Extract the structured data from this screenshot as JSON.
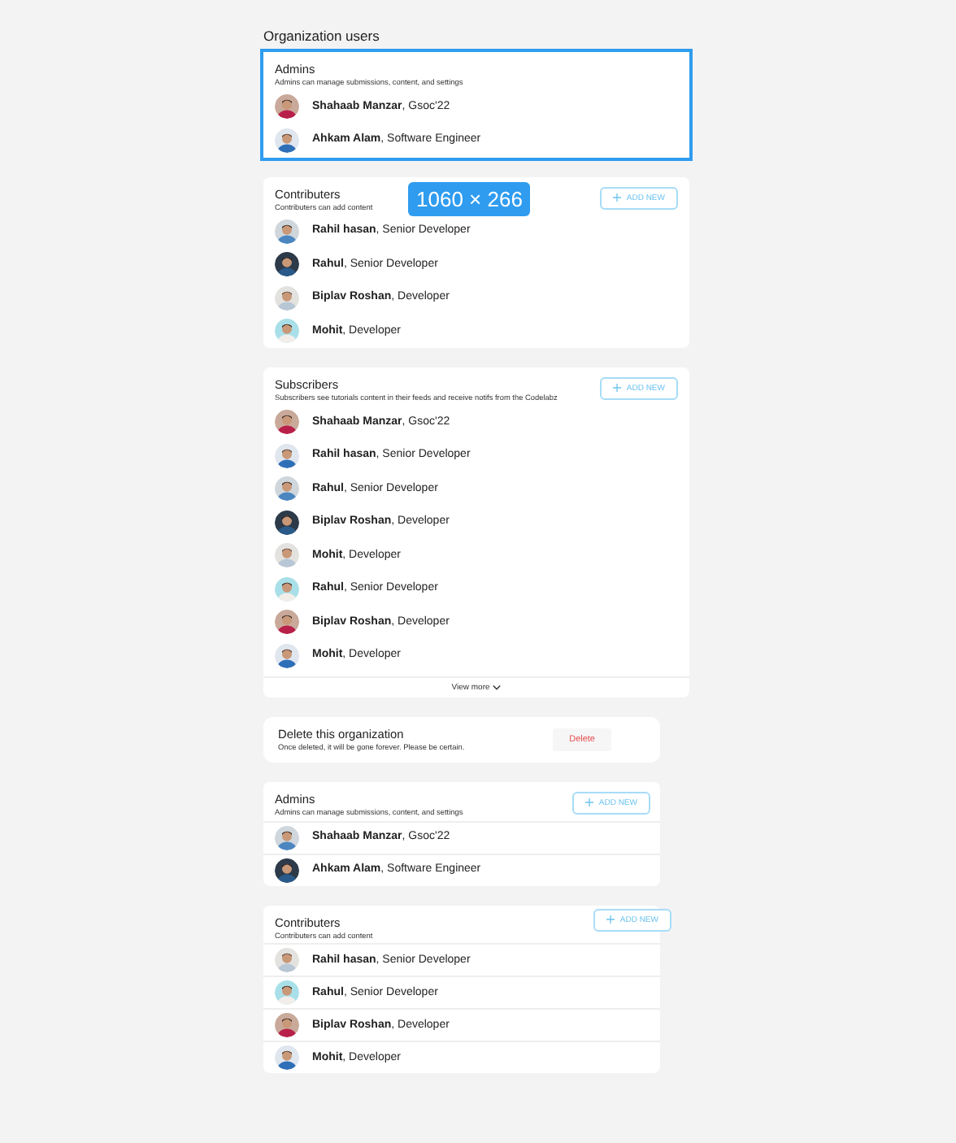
{
  "page_title": "Organization users",
  "selection": {
    "label": "1060 × 266"
  },
  "sections": [
    {
      "kind": "users",
      "selected": true,
      "title": "Admins",
      "subtitle": "Admins can manage submissions, content, and settings",
      "dividers": false,
      "users": [
        {
          "text": "**Shahaab Manzar**, Gsoc'22"
        },
        {
          "text": "**Ahkam Alam**, Software Engineer"
        }
      ]
    },
    {
      "kind": "users",
      "selected": false,
      "title": "Contributers",
      "subtitle": "Contributers can add content",
      "add_button": "ADD NEW",
      "dividers": false,
      "users": [
        {
          "text": "**Rahil hasan**, Senior Developer"
        },
        {
          "text": "**Rahul**, Senior Developer"
        },
        {
          "text": "**Biplav Roshan**, Developer"
        },
        {
          "text": "**Mohit**, Developer"
        }
      ]
    },
    {
      "kind": "users",
      "selected": false,
      "title": "Subscribers",
      "subtitle": "Subscribers see tutorials content in their feeds and receive notifs from the Codelabz",
      "add_button": "ADD NEW",
      "dividers": false,
      "users": [
        {
          "text": "**Shahaab Manzar**, Gsoc'22"
        },
        {
          "text": "**Rahil hasan**, Senior Developer"
        },
        {
          "text": "**Rahul**, Senior Developer"
        },
        {
          "text": "**Biplav Roshan**, Developer"
        },
        {
          "text": "**Mohit**, Developer"
        },
        {
          "text": "**Rahul**, Senior Developer"
        },
        {
          "text": "**Biplav Roshan**, Developer"
        },
        {
          "text": "**Mohit**, Developer"
        }
      ],
      "view_more": "View more"
    },
    {
      "kind": "danger",
      "title": "Delete this organization",
      "subtitle": "Once deleted, it will be gone forever. Please be certain.",
      "button": "Delete"
    },
    {
      "kind": "users",
      "selected": false,
      "title": "Admins",
      "subtitle": "Admins can manage submissions, content, and settings",
      "add_button": "ADD NEW",
      "dividers": true,
      "users": [
        {
          "text": "**Shahaab Manzar**, Gsoc'22"
        },
        {
          "text": "**Ahkam Alam**, Software Engineer"
        }
      ]
    },
    {
      "kind": "users",
      "selected": false,
      "title": "Contributers",
      "subtitle": "Contributers can add content",
      "add_button": "ADD NEW",
      "dividers": true,
      "users": [
        {
          "text": "**Rahil hasan**, Senior Developer"
        },
        {
          "text": "**Rahul**, Senior Developer"
        },
        {
          "text": "**Biplav Roshan**, Developer"
        },
        {
          "text": "**Mohit**, Developer"
        }
      ]
    }
  ]
}
